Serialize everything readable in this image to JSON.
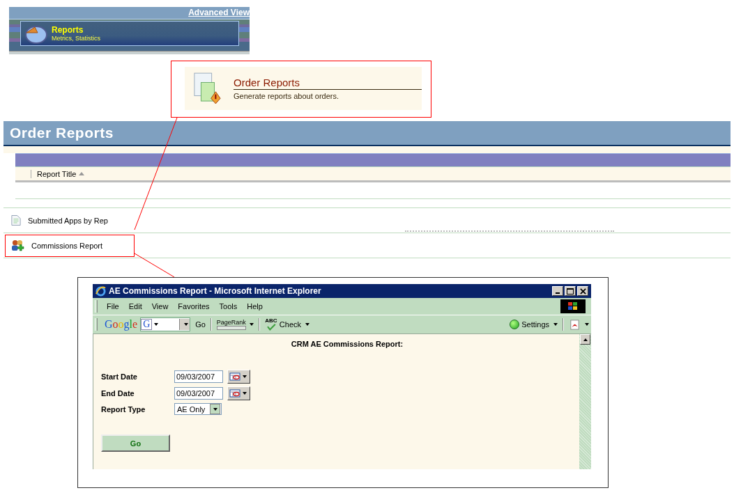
{
  "reports_banner": {
    "link": "Advanced View",
    "title": "Reports",
    "subtitle": "Metrics, Statistics"
  },
  "order_reports_card": {
    "title": "Order Reports",
    "description": "Generate reports about orders."
  },
  "order_reports_page": {
    "title": "Order Reports",
    "table": {
      "columns": [
        {
          "label": "Report Title",
          "sorted": true
        }
      ],
      "rows": [
        {
          "title": "Submitted Apps by Rep",
          "kind": "document",
          "highlighted": false
        },
        {
          "title": "Commissions Report",
          "kind": "people",
          "highlighted": true
        }
      ]
    }
  },
  "browser_window": {
    "title": "AE Commissions Report - Microsoft Internet Explorer",
    "menu": [
      "File",
      "Edit",
      "View",
      "Favorites",
      "Tools",
      "Help"
    ],
    "toolbar": {
      "logo": "Google",
      "engine": "G",
      "go": "Go",
      "spell_icon": "ABC",
      "pagerank": "PageRank",
      "check": "Check",
      "settings": "Settings"
    },
    "page": {
      "heading": "CRM AE Commissions Report:",
      "fields": [
        {
          "label": "Start Date",
          "kind": "date",
          "value": "09/03/2007"
        },
        {
          "label": "End Date",
          "kind": "date",
          "value": "09/03/2007"
        },
        {
          "label": "Report Type",
          "kind": "select",
          "value": "AE Only"
        }
      ],
      "button": "Go"
    }
  }
}
